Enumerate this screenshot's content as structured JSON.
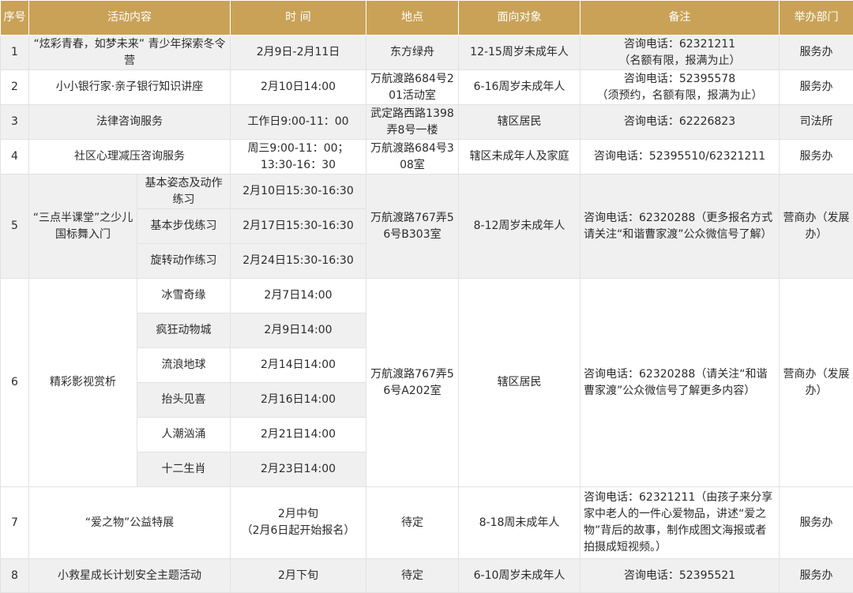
{
  "headers": {
    "index": "序号",
    "content": "活动内容",
    "time": "时 间",
    "place": "地点",
    "audience": "面向对象",
    "note": "备注",
    "dept": "举办部门"
  },
  "rows": [
    {
      "index": "1",
      "content": "“炫彩青春，如梦未来” 青少年探索冬令营",
      "time": "2月9日-2月11日",
      "place": "东方绿舟",
      "audience": "12-15周岁未成年人",
      "note_line1": "咨询电话：62321211",
      "note_line2": "（名额有限，报满为止）",
      "dept": "服务办"
    },
    {
      "index": "2",
      "content": "小小银行家·亲子银行知识讲座",
      "time": "2月10日14:00",
      "place": "万航渡路684号201活动室",
      "audience": "6-16周岁未成年人",
      "note_line1": "咨询电话：52395578",
      "note_line2": "（须预约，名额有限，报满为止）",
      "dept": "服务办"
    },
    {
      "index": "3",
      "content": "法律咨询服务",
      "time": "工作日9:00-11：00",
      "place": "武定路西路1398弄8号一楼",
      "audience": "辖区居民",
      "note_line1": "咨询电话：62226823",
      "dept": "司法所"
    },
    {
      "index": "4",
      "content": "社区心理减压咨询服务",
      "time_line1": "周三9:00-11：00；",
      "time_line2": "13:30-16：30",
      "place": "万航渡路684号308室",
      "audience": "辖区未成年人及家庭",
      "note_line1": "咨询电话：52395510/62321211",
      "dept": "服务办"
    },
    {
      "index": "5",
      "content": "“三点半课堂”之少儿国标舞入门",
      "sub": [
        {
          "item": "基本姿态及动作练习",
          "time": "2月10日15:30-16:30"
        },
        {
          "item": "基本步伐练习",
          "time": "2月17日15:30-16:30"
        },
        {
          "item": "旋转动作练习",
          "time": "2月24日15:30-16:30"
        }
      ],
      "place": "万航渡路767弄56号B303室",
      "audience": "8-12周岁未成年人",
      "note": "咨询电话：62320288（更多报名方式请关注“和谐曹家渡”公众微信号了解）",
      "dept": "营商办（发展办）"
    },
    {
      "index": "6",
      "content": "精彩影视赏析",
      "sub": [
        {
          "item": "冰雪奇缘",
          "time": "2月7日14:00"
        },
        {
          "item": "疯狂动物城",
          "time": "2月9日14:00"
        },
        {
          "item": "流浪地球",
          "time": "2月14日14:00"
        },
        {
          "item": "抬头见喜",
          "time": "2月16日14:00"
        },
        {
          "item": "人潮汹涌",
          "time": "2月21日14:00"
        },
        {
          "item": "十二生肖",
          "time": "2月23日14:00"
        }
      ],
      "place": "万航渡路767弄56号A202室",
      "audience": "辖区居民",
      "note": "咨询电话：62320288（请关注“和谐曹家渡”公众微信号了解更多内容）",
      "dept": "营商办（发展办）"
    },
    {
      "index": "7",
      "content": "“爱之物”公益特展",
      "time_line1": "2月中旬",
      "time_line2": "（2月6日起开始报名）",
      "place": "待定",
      "audience": "8-18周未成年人",
      "note": "咨询电话：62321211（由孩子来分享家中老人的一件心爱物品，讲述“爱之物”背后的故事，制作成图文海报或者拍摄成短视频。）",
      "dept": "服务办"
    },
    {
      "index": "8",
      "content": "小救星成长计划安全主题活动",
      "time": "2月下旬",
      "place": "待定",
      "audience": "6-10周岁未成年人",
      "note_line1": "咨询电话：52395521",
      "dept": "服务办"
    }
  ]
}
